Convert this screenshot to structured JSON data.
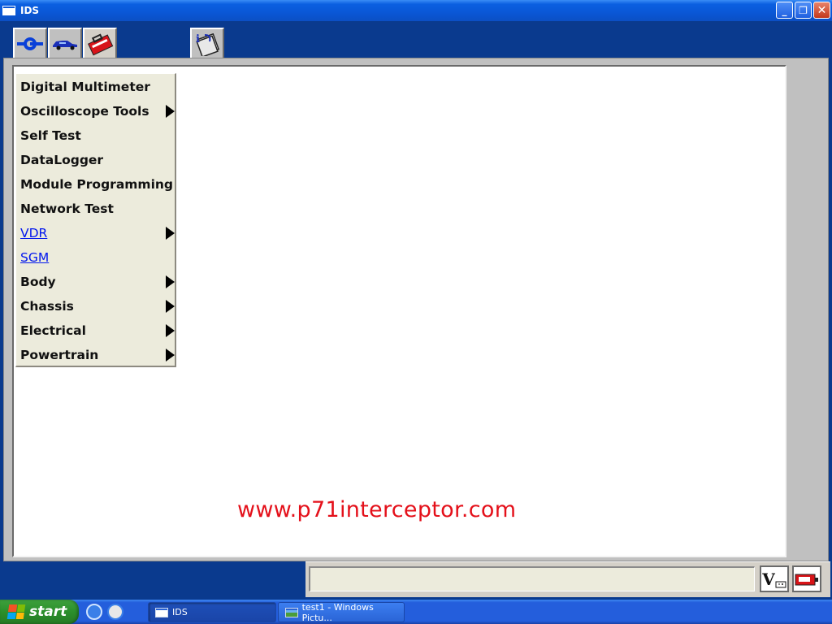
{
  "window": {
    "title": "IDS",
    "minimize_label": "_",
    "restore_label": "❐",
    "close_label": "✕"
  },
  "toolbar": {
    "tabs": [
      {
        "icon": "connect-icon"
      },
      {
        "icon": "vehicle-icon"
      },
      {
        "icon": "toolbox-icon"
      },
      {
        "icon": "info-book-icon"
      }
    ]
  },
  "menu": {
    "items": [
      {
        "label": "Digital Multimeter",
        "submenu": false,
        "link": false
      },
      {
        "label": "Oscilloscope Tools",
        "submenu": true,
        "link": false
      },
      {
        "label": "Self Test",
        "submenu": false,
        "link": false
      },
      {
        "label": "DataLogger",
        "submenu": false,
        "link": false
      },
      {
        "label": "Module Programming",
        "submenu": false,
        "link": false
      },
      {
        "label": "Network Test",
        "submenu": false,
        "link": false
      },
      {
        "label": "VDR",
        "submenu": true,
        "link": true
      },
      {
        "label": "SGM",
        "submenu": false,
        "link": true
      },
      {
        "label": "Body",
        "submenu": true,
        "link": false
      },
      {
        "label": "Chassis",
        "submenu": true,
        "link": false
      },
      {
        "label": "Electrical",
        "submenu": true,
        "link": false
      },
      {
        "label": "Powertrain",
        "submenu": true,
        "link": false
      }
    ]
  },
  "watermark": "www.p71interceptor.com",
  "status": {
    "voltage_icon": "V",
    "battery_icon": "battery-icon"
  },
  "taskbar": {
    "start_label": "start",
    "tasks": [
      {
        "label": "IDS"
      },
      {
        "label": "test1 - Windows Pictu..."
      }
    ]
  },
  "colors": {
    "accent": "#0a3a8e",
    "menu_bg": "#ecebdc",
    "link": "#0015ee",
    "watermark": "#e4101a"
  }
}
